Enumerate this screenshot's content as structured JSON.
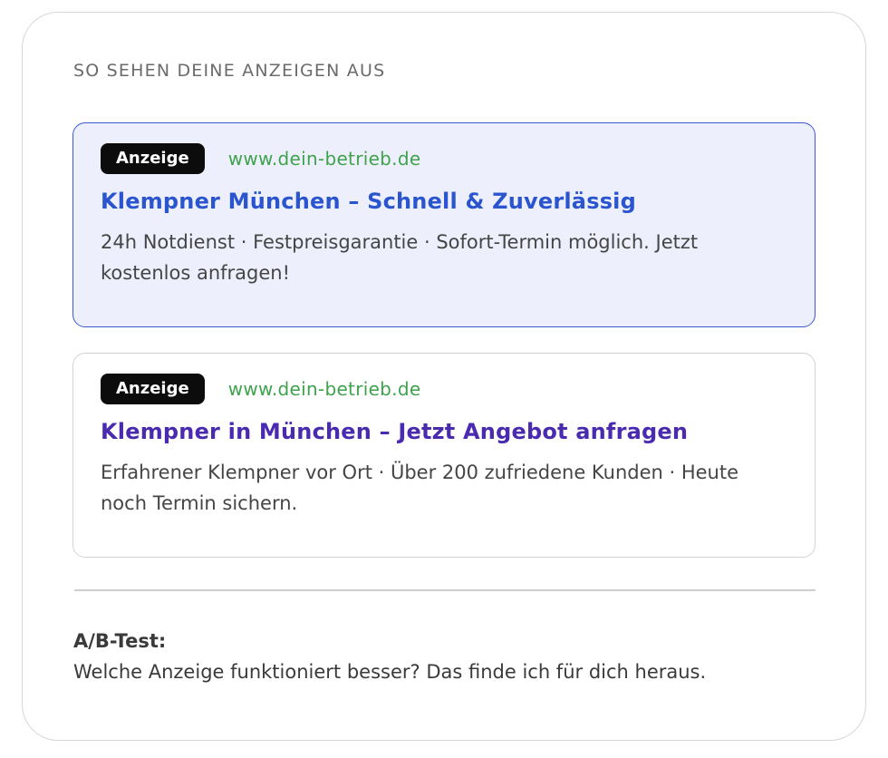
{
  "section_title": "SO SEHEN DEINE ANZEIGEN AUS",
  "ads": [
    {
      "badge": "Anzeige",
      "url": "www.dein-betrieb.de",
      "title": "Klempner München – Schnell & Zuverlässig",
      "description": "24h Notdienst · Festpreisgarantie · Sofort-Termin möglich. Jetzt kostenlos anfragen!"
    },
    {
      "badge": "Anzeige",
      "url": "www.dein-betrieb.de",
      "title": "Klempner in München – Jetzt Angebot anfragen",
      "description": "Erfahrener Klempner vor Ort · Über 200 zufriedene Kunden · Heute noch Termin sichern."
    }
  ],
  "ab_test": {
    "label": "A/B-Test:",
    "text": "Welche Anzeige funktioniert besser? Das finde ich für dich heraus."
  },
  "colors": {
    "active_border": "#3a5bd0",
    "active_bg": "#edf0fc",
    "url_green": "#3fa24c",
    "title_blue": "#2b55cf",
    "title_purple": "#4a2bb0"
  }
}
